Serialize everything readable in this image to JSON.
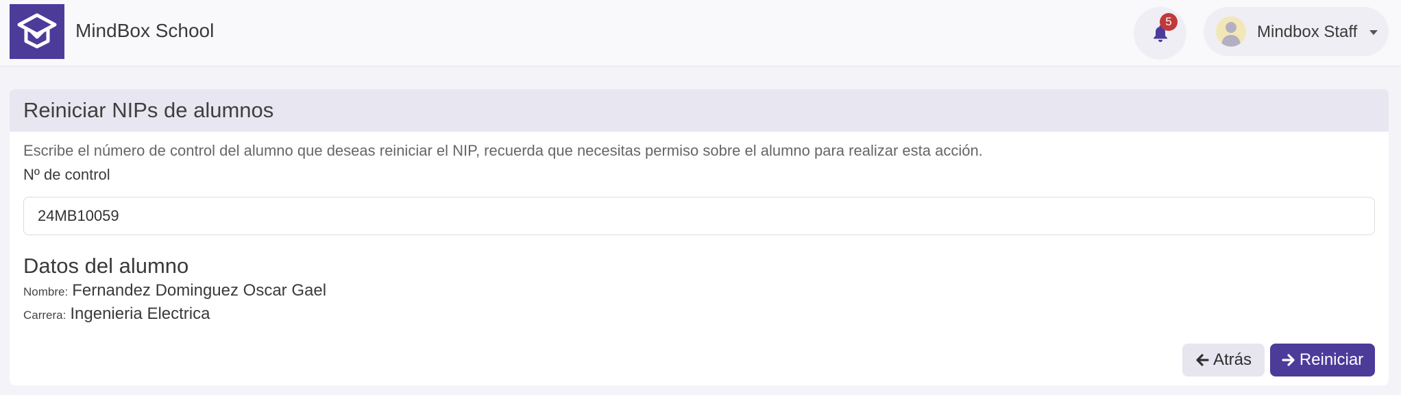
{
  "app": {
    "name": "MindBox School",
    "brand_color": "#4d3b9a",
    "logo_icon": "graduation-cap-icon"
  },
  "header": {
    "notifications": {
      "icon": "bell-icon",
      "count": "5",
      "badge_color": "#c0393b"
    },
    "user": {
      "name": "Mindbox Staff",
      "avatar_icon": "user-avatar-icon",
      "dropdown_icon": "caret-down-icon"
    }
  },
  "card": {
    "title": "Reiniciar NIPs de alumnos",
    "description": "Escribe el número de control del alumno que deseas reiniciar el NIP, recuerda que necesitas permiso sobre el alumno para realizar esta acción.",
    "field_label": "Nº de control",
    "control_number_value": "24MB10059",
    "student_section_title": "Datos del alumno",
    "student": {
      "name_label": "Nombre:",
      "name_value": "Fernandez Dominguez Oscar Gael",
      "career_label": "Carrera:",
      "career_value": "Ingenieria Electrica"
    },
    "actions": {
      "back_label": "Atrás",
      "back_icon": "arrow-left-icon",
      "reset_label": "Reiniciar",
      "reset_icon": "arrow-right-icon"
    }
  }
}
